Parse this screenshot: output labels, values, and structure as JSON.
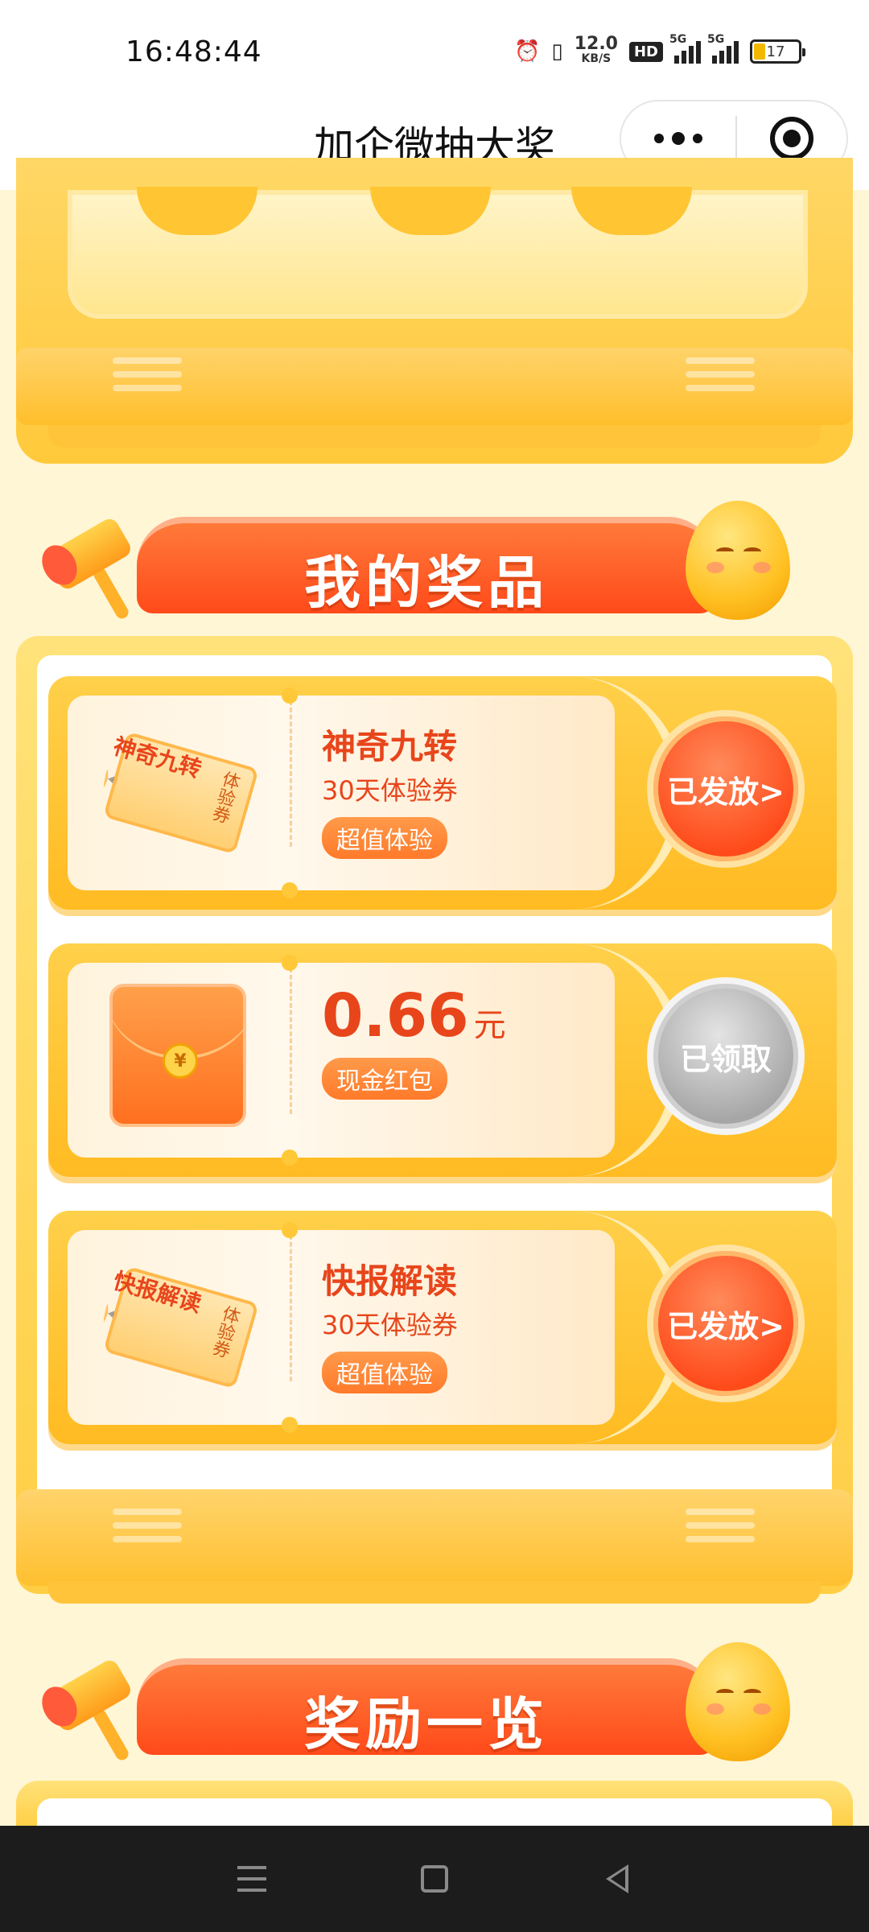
{
  "status_bar": {
    "time": "16:48:44",
    "net_speed_value": "12.0",
    "net_speed_unit": "KB/S",
    "hd_label": "HD",
    "sim1_label": "5G",
    "sim2_label": "5G",
    "battery": "17",
    "icons": [
      "alarm-icon",
      "vibrate-icon"
    ]
  },
  "header": {
    "title": "加企微抽大奖",
    "more_icon": "more-icon",
    "close_icon": "target-icon"
  },
  "prizes_section": {
    "title": "我的奖品",
    "items": [
      {
        "thumb_text": "神奇九转",
        "thumb_sub": "体验券",
        "name": "神奇九转",
        "sub": "30天体验券",
        "tag": "超值体验",
        "button": "已发放>",
        "button_state": "issued"
      },
      {
        "thumb_coin": "¥",
        "amount": "0.66",
        "unit": "元",
        "tag": "现金红包",
        "button": "已领取",
        "button_state": "claimed"
      },
      {
        "thumb_text": "快报解读",
        "thumb_sub": "体验券",
        "name": "快报解读",
        "sub": "30天体验券",
        "tag": "超值体验",
        "button": "已发放>",
        "button_state": "issued"
      }
    ]
  },
  "rewards_section": {
    "title": "奖励一览"
  },
  "colors": {
    "accent": "#e8451b",
    "panel": "#ffce44",
    "background": "#fff6d6"
  },
  "nav_bar": {
    "icons": [
      "menu-icon",
      "home-icon",
      "back-icon"
    ]
  }
}
